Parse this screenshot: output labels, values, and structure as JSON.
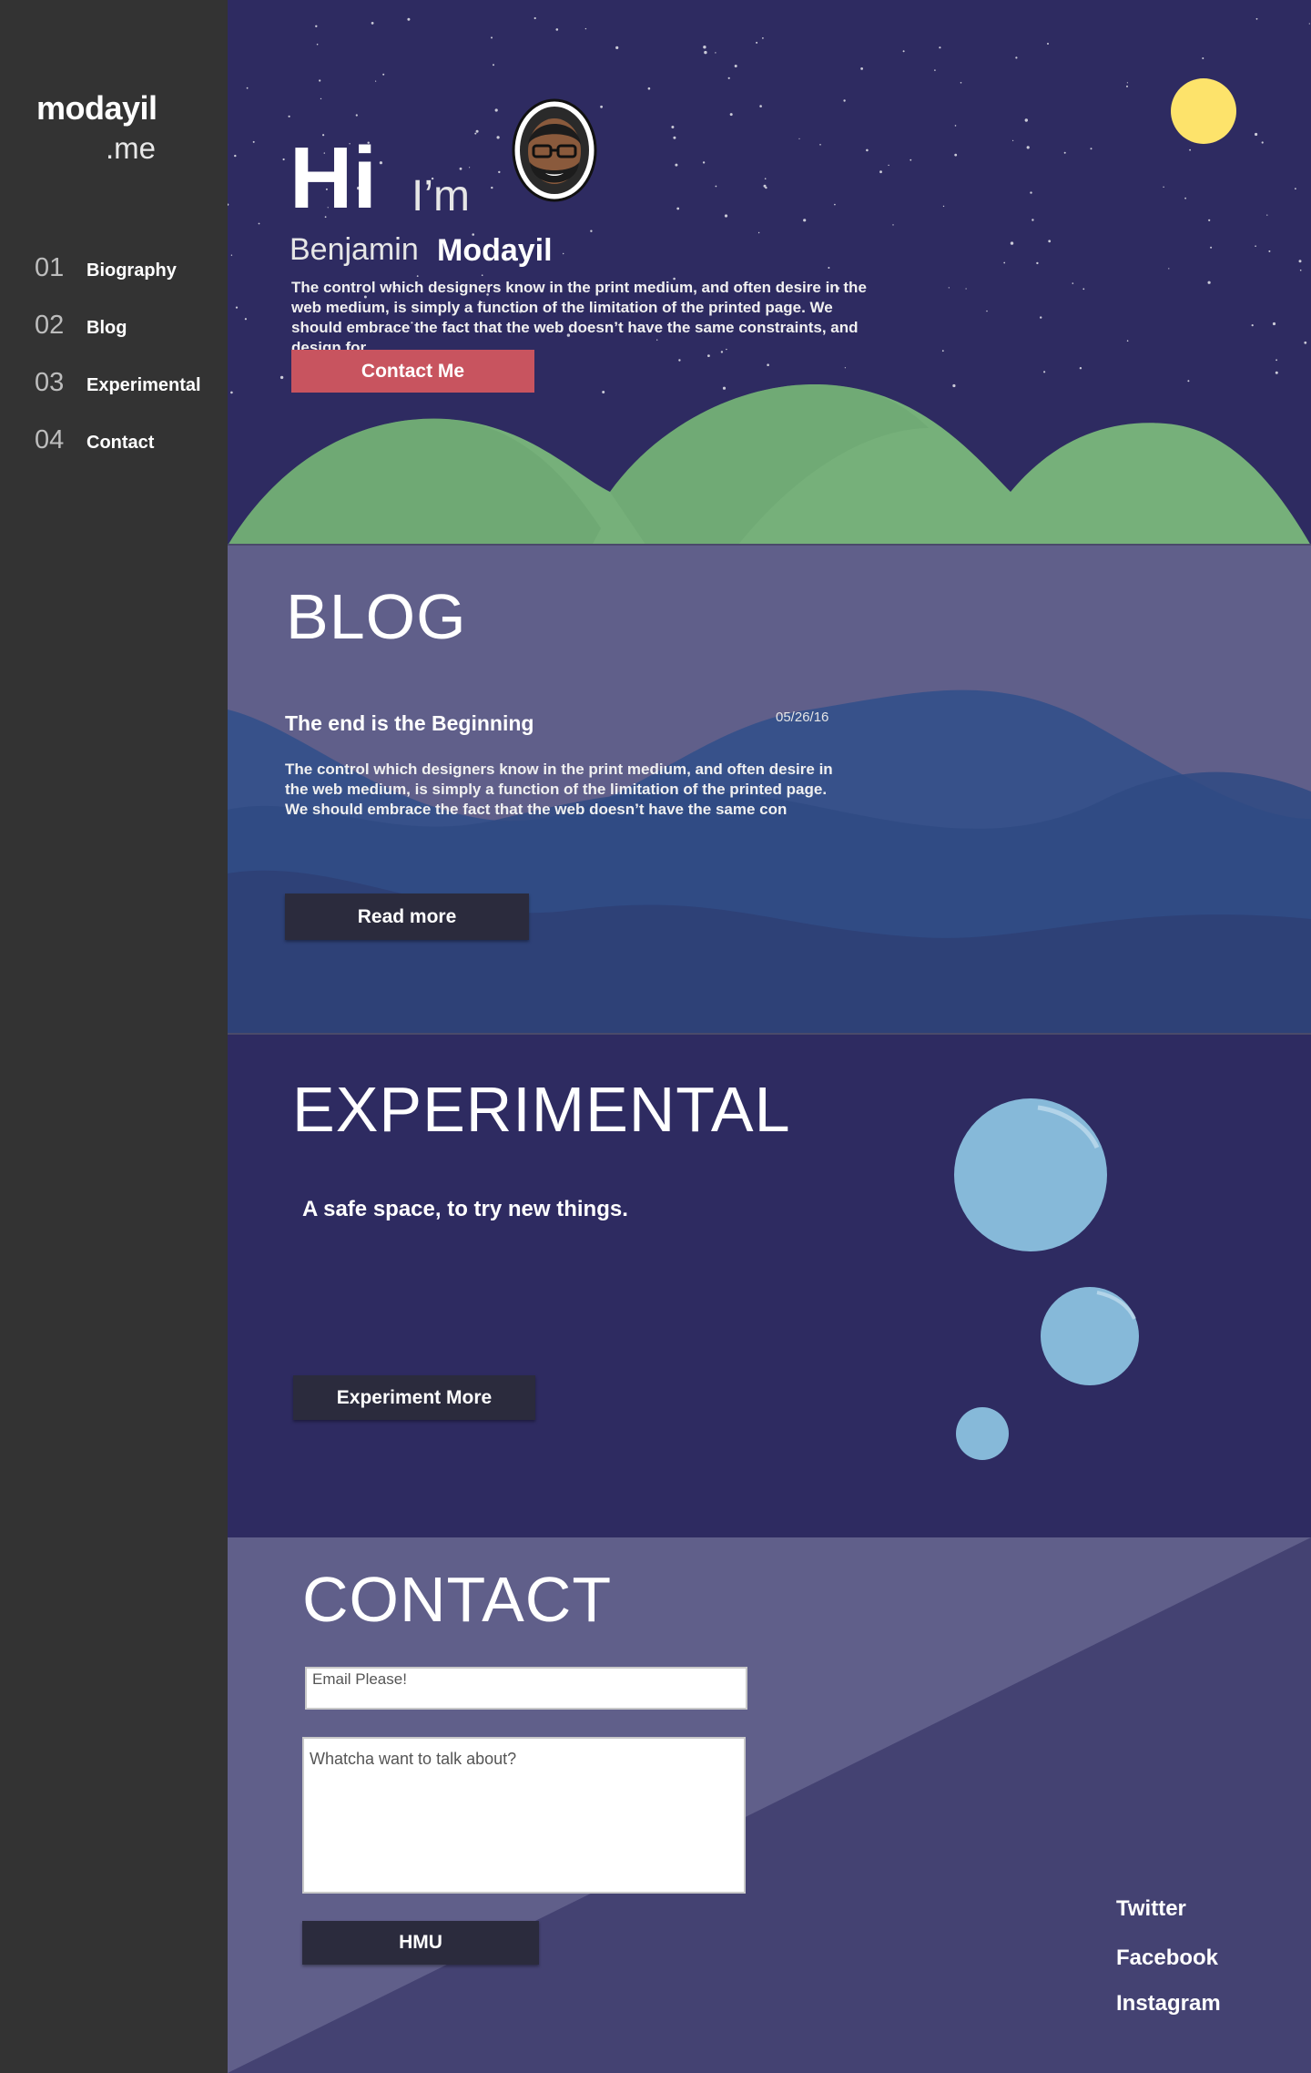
{
  "brand": {
    "name": "modayil",
    "suffix": ".me"
  },
  "nav": [
    {
      "num": "01",
      "label": "Biography"
    },
    {
      "num": "02",
      "label": "Blog"
    },
    {
      "num": "03",
      "label": "Experimental"
    },
    {
      "num": "04",
      "label": "Contact"
    }
  ],
  "hero": {
    "greeting": "Hi",
    "im": "I’m",
    "first_name": "Benjamin",
    "last_name": "Modayil",
    "description": "The control which designers know in the print medium, and often desire in the web medium, is simply a function of the limitation of the printed page. We should embrace the fact that the web doesn’t have the same constraints, and design for",
    "cta": "Contact Me"
  },
  "blog": {
    "heading": "BLOG",
    "post": {
      "title": "The end is the Beginning",
      "date": "05/26/16",
      "excerpt": "The control which designers know in the print medium, and often desire in the web medium, is simply a function of the limitation of the printed page. We should embrace the fact that the web doesn’t have the same con"
    },
    "read_more": "Read more"
  },
  "experimental": {
    "heading": "EXPERIMENTAL",
    "subtitle": "A safe space, to try new things.",
    "button": "Experiment More"
  },
  "contact": {
    "heading": "CONTACT",
    "email_placeholder": "Email Please!",
    "message_placeholder": "Whatcha want to talk about?",
    "submit": "HMU",
    "social": {
      "twitter": "Twitter",
      "facebook": "Facebook",
      "instagram": "Instagram"
    }
  },
  "colors": {
    "sidebar": "#333333",
    "night_sky": "#2e2b61",
    "moon": "#fde36b",
    "hills": "#76b07a",
    "accent_button": "#c8545f",
    "blog_bg": "#605f8a",
    "waves": "#33508a",
    "bubbles": "#86b9d9",
    "dark_button": "#2b2b3d"
  },
  "icons": {
    "moon": "moon-icon",
    "avatar": "avatar-icon",
    "bubble": "bubble-icon"
  }
}
